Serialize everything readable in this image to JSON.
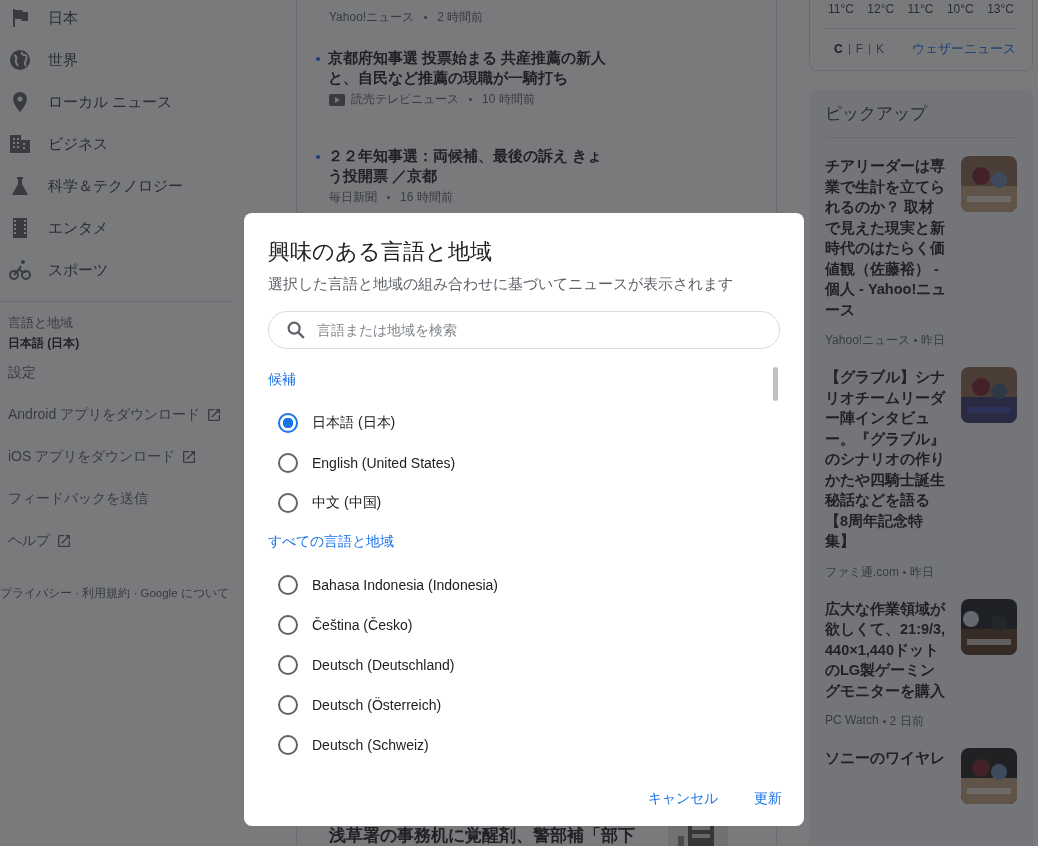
{
  "sidebar": {
    "nav_items": [
      {
        "label": "日本"
      },
      {
        "label": "世界"
      },
      {
        "label": "ローカル ニュース"
      },
      {
        "label": "ビジネス"
      },
      {
        "label": "科学＆テクノロジー"
      },
      {
        "label": "エンタメ"
      },
      {
        "label": "スポーツ"
      }
    ],
    "language_region": {
      "label": "言語と地域",
      "value": "日本語 (日本)"
    },
    "links": [
      {
        "label": "設定",
        "external": false
      },
      {
        "label": "Android アプリをダウンロード",
        "external": true
      },
      {
        "label": "iOS アプリをダウンロード",
        "external": true
      },
      {
        "label": "フィードバックを送信",
        "external": false
      },
      {
        "label": "ヘルプ",
        "external": true
      }
    ],
    "footer": "プライバシー · 利用規約 · Google について"
  },
  "news": {
    "articles": [
      {
        "source": "Yahoo!ニュース",
        "time": "2 時間前",
        "video": false
      },
      {
        "title": "京都府知事選 投票始まる 共産推薦の新人と、自民など推薦の現職が一騎打ち",
        "source": "読売テレビニュース",
        "time": "10 時間前",
        "video": true
      },
      {
        "title": "２２年知事選：両候補、最後の訴え きょう投開票 ／京都",
        "source": "毎日新聞",
        "time": "16 時間前",
        "video": false
      }
    ],
    "bottom_headline": "浅草署の事務机に覚醒剤、警部補「部下"
  },
  "weather": {
    "temperatures": [
      "11°C",
      "12°C",
      "11°C",
      "10°C",
      "13°C"
    ],
    "units": [
      {
        "label": "C",
        "selected": true
      },
      {
        "label": "F",
        "selected": false
      },
      {
        "label": "K",
        "selected": false
      }
    ],
    "link": "ウェザーニュース"
  },
  "pickup": {
    "title": "ピックアップ",
    "articles": [
      {
        "title": "チアリーダーは専業で生計を立てられるのか？ 取材で見えた現実と新時代のはたらく価値観（佐藤裕） - 個人 - Yahoo!ニュース",
        "source": "Yahoo!ニュース",
        "time": "昨日"
      },
      {
        "title": "【グラブル】シナリオチームリーダー陣インタビュー。『グラブル』のシナリオの作りかたや四騎士誕生秘話などを語る【8周年記念特集】",
        "source": "ファミ通.com",
        "time": "昨日"
      },
      {
        "title": "広大な作業領域が欲しくて、21:9/3,440×1,440ドットのLG製ゲーミングモニターを購入",
        "source": "PC Watch",
        "time": "2 日前"
      },
      {
        "title": "ソニーのワイヤレ"
      }
    ]
  },
  "dialog": {
    "title": "興味のある言語と地域",
    "subtitle": "選択した言語と地域の組み合わせに基づいてニュースが表示されます",
    "search": {
      "placeholder": "言語または地域を検索"
    },
    "sections": [
      {
        "label": "候補",
        "options": [
          {
            "label": "日本語 (日本)",
            "selected": true
          },
          {
            "label": "English (United States)",
            "selected": false
          },
          {
            "label": "中文 (中国)",
            "selected": false
          }
        ]
      },
      {
        "label": "すべての言語と地域",
        "options": [
          {
            "label": "Bahasa Indonesia (Indonesia)",
            "selected": false
          },
          {
            "label": "Čeština (Česko)",
            "selected": false
          },
          {
            "label": "Deutsch (Deutschland)",
            "selected": false
          },
          {
            "label": "Deutsch (Österreich)",
            "selected": false
          },
          {
            "label": "Deutsch (Schweiz)",
            "selected": false
          }
        ]
      }
    ],
    "buttons": [
      "キャンセル",
      "更新"
    ]
  }
}
